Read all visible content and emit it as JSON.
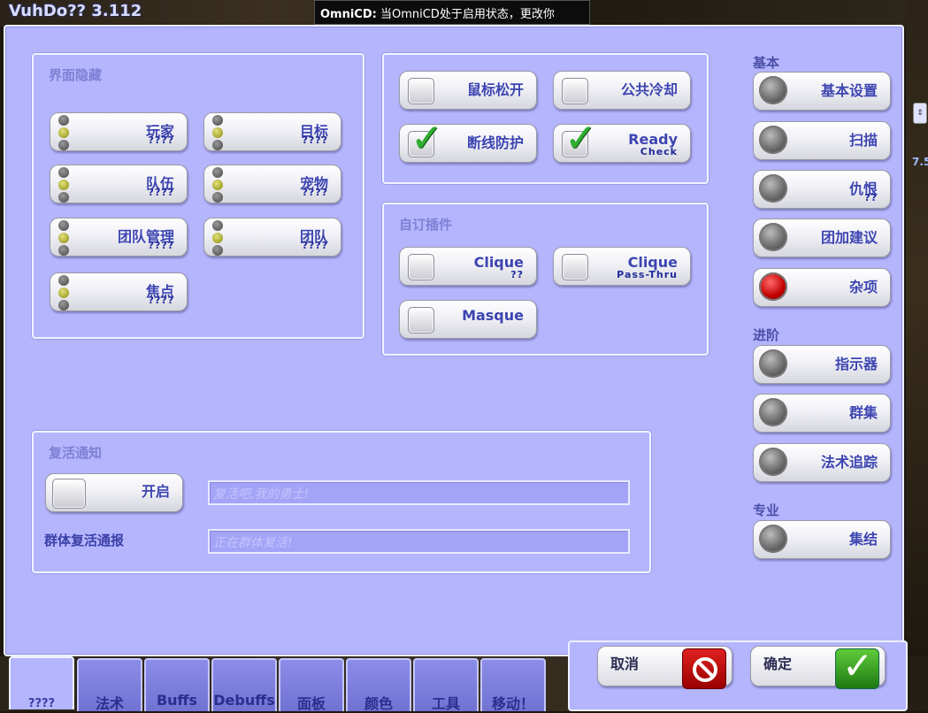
{
  "window": {
    "title": "VuhDo?? 3.112"
  },
  "notice": {
    "app": "OmniCD:",
    "text": "当OmniCD处于启用状态，更改你"
  },
  "edge": {
    "number": "7.5"
  },
  "hide_box": {
    "title": "界面隐藏",
    "items": [
      {
        "label": "玩家",
        "sub": "????"
      },
      {
        "label": "目标",
        "sub": "????"
      },
      {
        "label": "队伍",
        "sub": "????"
      },
      {
        "label": "宠物",
        "sub": "????"
      },
      {
        "label": "团队管理",
        "sub": "????"
      },
      {
        "label": "团队",
        "sub": "????"
      },
      {
        "label": "焦点",
        "sub": "????"
      }
    ]
  },
  "options_box": {
    "items": [
      {
        "label": "鼠标松开",
        "checked": false
      },
      {
        "label": "公共冷却",
        "checked": false
      },
      {
        "label": "断线防护",
        "checked": true
      },
      {
        "label": "Ready",
        "sub": "Check",
        "checked": true
      }
    ]
  },
  "plugins_box": {
    "title": "自订插件",
    "items": [
      {
        "label": "Clique",
        "sub": "??",
        "checked": false
      },
      {
        "label": "Clique",
        "sub": "Pass-Thru",
        "checked": false
      },
      {
        "label": "Masque",
        "checked": false
      }
    ]
  },
  "resurrect_box": {
    "title": "复活通知",
    "toggle_label": "开启",
    "input1_value": "复活吧,我的勇士!",
    "mass_label": "群体复活通报",
    "input2_value": "正在群体复活!"
  },
  "sidebar": {
    "basic_header": "基本",
    "basic": [
      {
        "label": "基本设置",
        "active": false
      },
      {
        "label": "扫描",
        "active": false
      },
      {
        "label": "仇恨",
        "sub": "??",
        "active": false
      },
      {
        "label": "团加建议",
        "active": false
      },
      {
        "label": "杂项",
        "active": true
      }
    ],
    "advanced_header": "进阶",
    "advanced": [
      {
        "label": "指示器"
      },
      {
        "label": "群集"
      },
      {
        "label": "法术追踪"
      }
    ],
    "expert_header": "专业",
    "expert": [
      {
        "label": "集结"
      }
    ]
  },
  "actions": {
    "cancel": "取消",
    "ok": "确定"
  },
  "tabs": [
    "????",
    "法术",
    "Buffs",
    "Debuffs",
    "面板",
    "颜色",
    "工具",
    "移动！"
  ]
}
